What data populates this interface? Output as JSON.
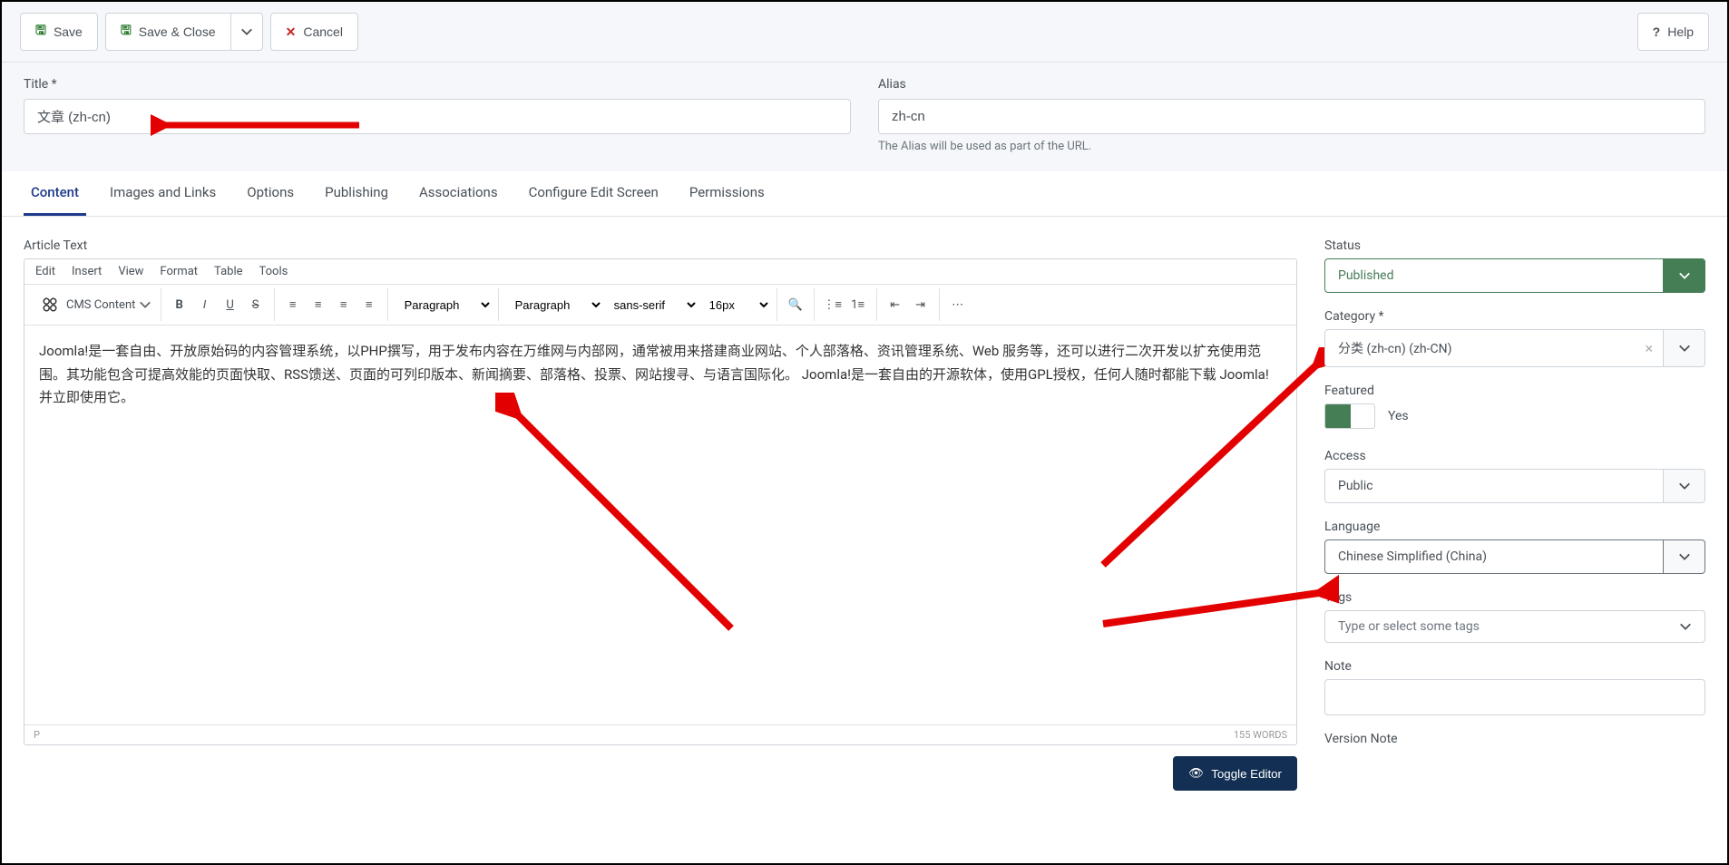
{
  "toolbar": {
    "save": "Save",
    "save_close": "Save & Close",
    "cancel": "Cancel",
    "help": "Help"
  },
  "title_field": {
    "label": "Title *",
    "value": "文章 (zh-cn)"
  },
  "alias_field": {
    "label": "Alias",
    "value": "zh-cn",
    "help": "The Alias will be used as part of the URL."
  },
  "tabs": [
    "Content",
    "Images and Links",
    "Options",
    "Publishing",
    "Associations",
    "Configure Edit Screen",
    "Permissions"
  ],
  "editor": {
    "label": "Article Text",
    "menus": [
      "Edit",
      "Insert",
      "View",
      "Format",
      "Table",
      "Tools"
    ],
    "cms_content": "CMS Content",
    "para1": "Paragraph",
    "para2": "Paragraph",
    "font": "sans-serif",
    "size": "16px",
    "content": "Joomla!是一套自由、开放原始码的内容管理系统，以PHP撰写，用于发布内容在万维网与内部网，通常被用来搭建商业网站、个人部落格、资讯管理系统、Web 服务等，还可以进行二次开发以扩充使用范围。其功能包含可提高效能的页面快取、RSS馈送、页面的可列印版本、新闻摘要、部落格、投票、网站搜寻、与语言国际化。 Joomla!是一套自由的开源软体，使用GPL授权，任何人随时都能下载 Joomla! 并立即使用它。",
    "status_path": "P",
    "words": "155 WORDS",
    "toggle": "Toggle Editor"
  },
  "sidebar": {
    "status": {
      "label": "Status",
      "value": "Published"
    },
    "category": {
      "label": "Category *",
      "value": "分类 (zh-cn) (zh-CN)"
    },
    "featured": {
      "label": "Featured",
      "text": "Yes"
    },
    "access": {
      "label": "Access",
      "value": "Public"
    },
    "language": {
      "label": "Language",
      "value": "Chinese Simplified (China)"
    },
    "tags": {
      "label": "Tags",
      "placeholder": "Type or select some tags"
    },
    "note": {
      "label": "Note"
    },
    "version": {
      "label": "Version Note"
    }
  }
}
